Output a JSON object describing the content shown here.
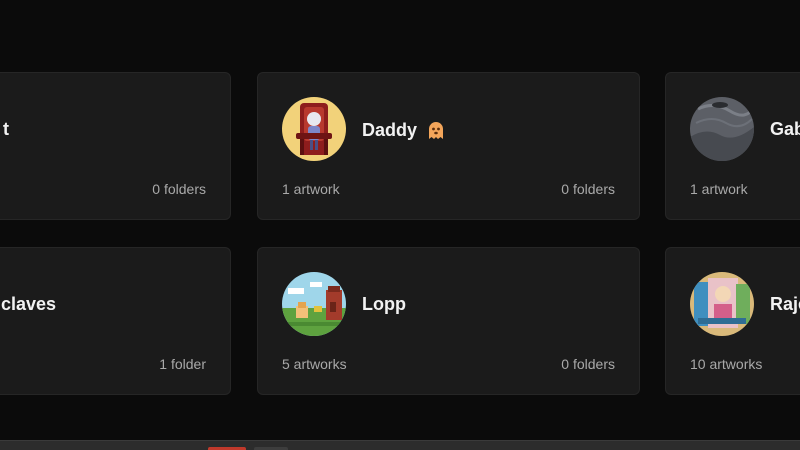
{
  "cards": [
    {
      "name": "",
      "name_fragment": "t",
      "artworks": "",
      "folders": "0 folders"
    },
    {
      "name": "Daddy",
      "emoji": "ghost-emoji-icon",
      "artworks": "1 artwork",
      "folders": "0 folders"
    },
    {
      "name": "Gab",
      "artworks": "1 artwork",
      "folders": ""
    },
    {
      "name": "claves",
      "artworks": "",
      "folders": "1 folder"
    },
    {
      "name": "Lopp",
      "artworks": "5 artworks",
      "folders": "0 folders"
    },
    {
      "name": "Raje",
      "artworks": "10 artworks",
      "folders": ""
    }
  ],
  "colors": {
    "page_background": "#0b0b0b",
    "card_background": "#1b1b1b",
    "card_border": "#262626",
    "name_text": "#f2f2f2",
    "meta_text": "#a9a9a9",
    "taskbar_accent_red": "#c0392b"
  }
}
